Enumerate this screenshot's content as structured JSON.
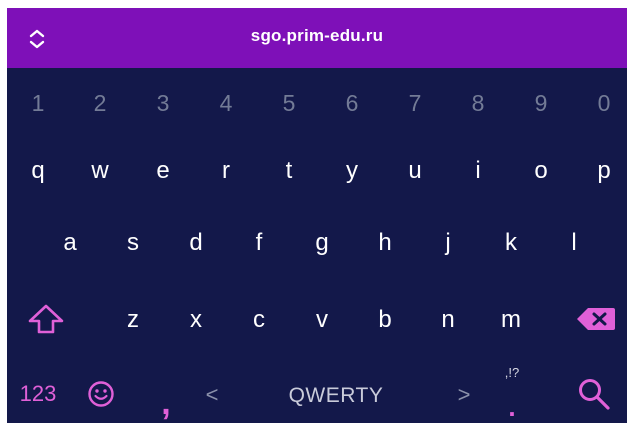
{
  "url_bar": {
    "url": "sgo.prim-edu.ru",
    "expand_icon": "chevron-up-down-icon"
  },
  "keyboard": {
    "number_row": [
      "1",
      "2",
      "3",
      "4",
      "5",
      "6",
      "7",
      "8",
      "9",
      "0"
    ],
    "row1": [
      "q",
      "w",
      "e",
      "r",
      "t",
      "y",
      "u",
      "i",
      "o",
      "p"
    ],
    "row2": [
      "a",
      "s",
      "d",
      "f",
      "g",
      "h",
      "j",
      "k",
      "l"
    ],
    "row3": [
      "z",
      "x",
      "c",
      "v",
      "b",
      "n",
      "m"
    ],
    "shift_icon": "shift-arrow-icon",
    "backspace_icon": "backspace-icon",
    "bottom": {
      "symbols_label": "123",
      "emoji_icon": "smiley-icon",
      "comma": ",",
      "prev_layout": "<",
      "layout_label": "QWERTY",
      "next_layout": ">",
      "punctuation_hint": ",!?",
      "period": ".",
      "search_icon": "search-icon"
    }
  },
  "colors": {
    "url_bar": "#7e10b8",
    "keyboard_bg": "#13184a",
    "accent": "#e060d8",
    "number_text": "#737b96"
  }
}
